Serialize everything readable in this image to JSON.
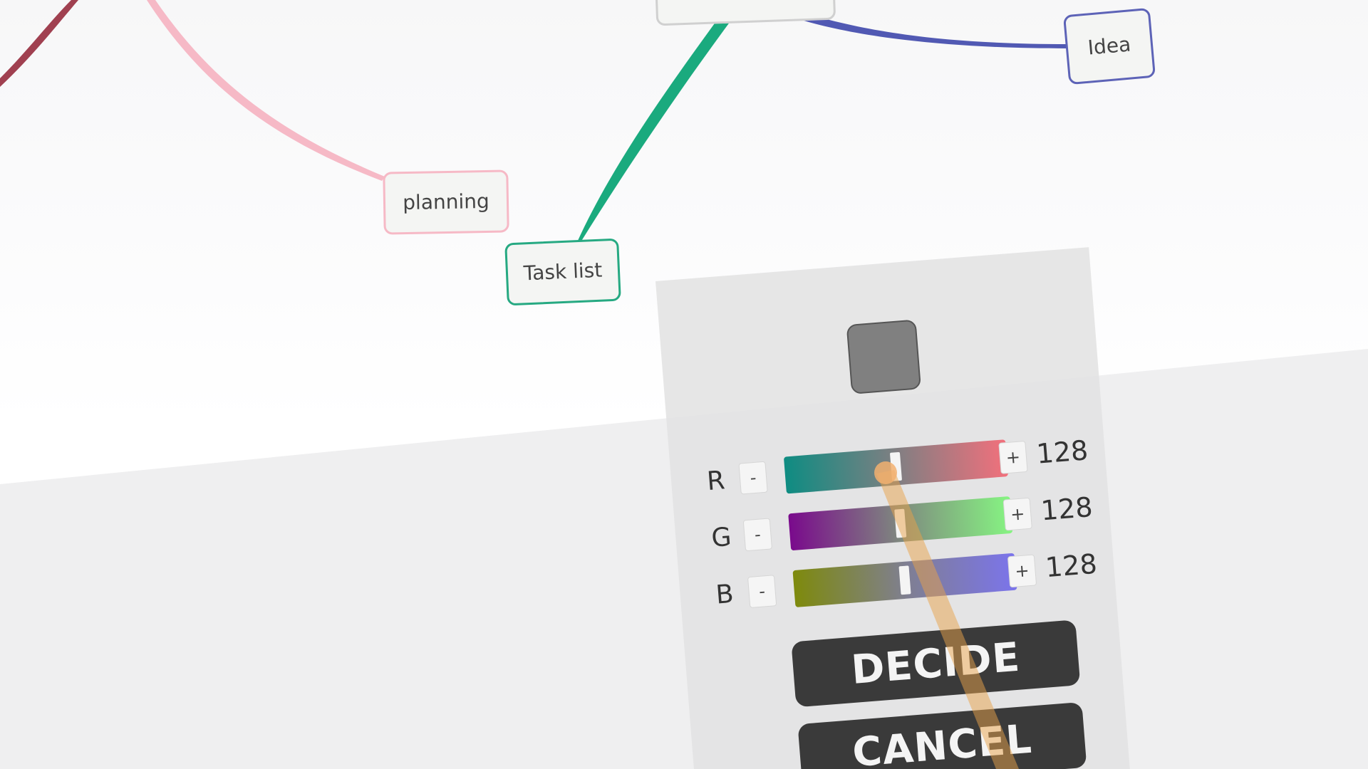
{
  "mindmap": {
    "nodes": {
      "root": "",
      "planning": "planning",
      "task_list": "Task list",
      "idea": "Idea"
    },
    "branch_colors": {
      "dark_branch": "#a04050",
      "planning": "#f6b9c6",
      "task_list": "#1aaa7e",
      "idea": "#5159b3"
    }
  },
  "color_picker": {
    "preview_color": "#808080",
    "channels": [
      {
        "label": "R",
        "minus": "-",
        "plus": "+",
        "value": "128",
        "level": 0.5
      },
      {
        "label": "G",
        "minus": "-",
        "plus": "+",
        "value": "128",
        "level": 0.5
      },
      {
        "label": "B",
        "minus": "-",
        "plus": "+",
        "value": "128",
        "level": 0.5
      }
    ],
    "decide_label": "DECIDE",
    "cancel_label": "CANCEL"
  },
  "pointer": {
    "color": "#e8a24a"
  }
}
